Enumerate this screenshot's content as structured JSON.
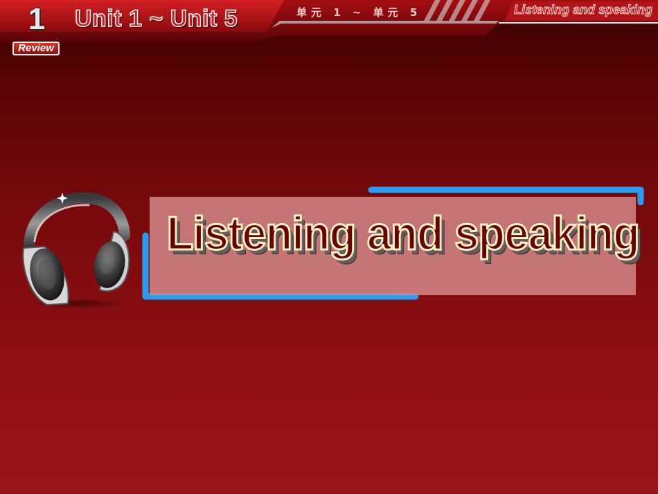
{
  "header": {
    "badge_number": "1",
    "badge_label": "Review",
    "unit_range": "Unit 1 ~ Unit 5",
    "unit_range_cn": "单元 1 ~ 单元 5",
    "section_tag": "Listening and speaking"
  },
  "main": {
    "title": "Listening and speaking"
  },
  "icons": {
    "headphones": "headphones-icon"
  },
  "colors": {
    "accent_blue": "#2a9cf0",
    "header_red": "#c0141a",
    "title_dark_red": "#6a0000"
  }
}
